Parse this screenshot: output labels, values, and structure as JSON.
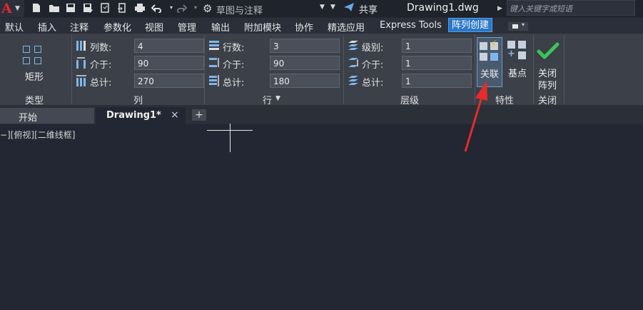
{
  "titlebar": {
    "logo_letter": "A",
    "logo_caret": "▼",
    "workspace": "草图与注释",
    "workspace_caret": "▼",
    "extra_caret": "▼",
    "share": "共享",
    "document_title": "Drawing1.dwg",
    "search_placeholder": "键入关键字或短语"
  },
  "ribbon_tabs": [
    "默认",
    "插入",
    "注释",
    "参数化",
    "视图",
    "管理",
    "输出",
    "附加模块",
    "协作",
    "精选应用",
    "Express Tools",
    "阵列创建"
  ],
  "ribbon": {
    "type_panel": {
      "button_label": "矩形",
      "title": "类型"
    },
    "column_panel": {
      "title": "列",
      "fields": [
        {
          "label": "列数:",
          "value": "4"
        },
        {
          "label": "介于:",
          "value": "90"
        },
        {
          "label": "总计:",
          "value": "270"
        }
      ]
    },
    "row_panel": {
      "title": "行",
      "title_caret": "▼",
      "fields": [
        {
          "label": "行数:",
          "value": "3"
        },
        {
          "label": "介于:",
          "value": "90"
        },
        {
          "label": "总计:",
          "value": "180"
        }
      ]
    },
    "level_panel": {
      "title": "层级",
      "fields": [
        {
          "label": "级别:",
          "value": "1"
        },
        {
          "label": "介于:",
          "value": "1"
        },
        {
          "label": "总计:",
          "value": "1"
        }
      ]
    },
    "properties_panel": {
      "title": "特性",
      "associative": "关联",
      "base_point": "基点"
    },
    "close_panel": {
      "title": "关闭",
      "line1": "关闭",
      "line2": "阵列"
    }
  },
  "doc_tabs": {
    "start": "开始",
    "active": "Drawing1*",
    "close": "×",
    "new": "+"
  },
  "canvas": {
    "view_label": "−][俯视][二维线框]"
  },
  "colors": {
    "active_tab": "#2a78c6",
    "annotation_arrow": "#e52b2b",
    "accent_icon": "#7fb6e8",
    "close_check": "#3cc45a"
  }
}
